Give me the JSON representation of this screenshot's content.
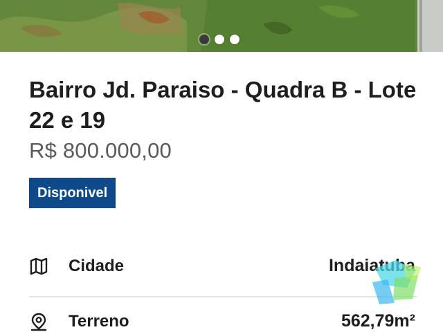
{
  "photo": {
    "carousel_pages": 3,
    "active_index": 1
  },
  "listing": {
    "title": "Bairro Jd. Paraiso - Quadra B - Lote 22 e 19",
    "price": "R$ 800.000,00",
    "status": "Disponivel",
    "status_color": "#0d4a8a"
  },
  "details": [
    {
      "icon": "map-icon",
      "label": "Cidade",
      "value": "Indaiatuba"
    },
    {
      "icon": "location-pin-icon",
      "label": "Terreno",
      "value": "562,79m²"
    }
  ]
}
